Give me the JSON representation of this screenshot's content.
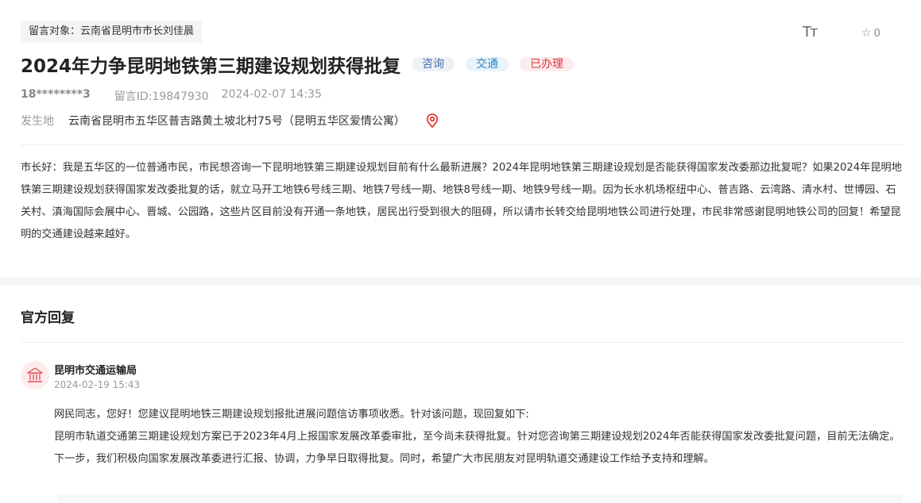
{
  "header": {
    "target_tag": "留言对象：云南省昆明市市长刘佳晨",
    "font_size_icon": "Tт",
    "favorite_count": "0",
    "title": "2024年力争昆明地铁第三期建设规划获得批复",
    "tags": {
      "consult": "咨询",
      "traffic": "交通",
      "status": "已办理"
    }
  },
  "meta": {
    "user": "18********3",
    "message_id": "留言ID:19847930",
    "datetime": "2024-02-07 14:35"
  },
  "place": {
    "label": "发生地",
    "value": "云南省昆明市五华区普吉路黄土坡北村75号（昆明五华区爱情公寓）"
  },
  "message": {
    "content": "市长好：我是五华区的一位普通市民，市民想咨询一下昆明地铁第三期建设规划目前有什么最新进展？2024年昆明地铁第三期建设规划是否能获得国家发改委那边批复呢？如果2024年昆明地铁第三期建设规划获得国家发改委批复的话，就立马开工地铁6号线三期、地铁7号线一期、地铁8号线一期、地铁9号线一期。因为长水机场枢纽中心、普吉路、云湾路、清水村、世博园、石关村、滇海国际会展中心、晋城、公园路，这些片区目前没有开通一条地铁，居民出行受到很大的阻碍，所以请市长转交给昆明地铁公司进行处理，市民非常感谢昆明地铁公司的回复！希望昆明的交通建设越来越好。"
  },
  "reply": {
    "heading": "官方回复",
    "org_name": "昆明市交通运输局",
    "date": "2024-02-19 15:43",
    "paragraph1": "网民同志，您好！您建议昆明地铁三期建设规划报批进展问题信访事项收悉。针对该问题，现回复如下:",
    "paragraph2": "昆明市轨道交通第三期建设规划方案已于2023年4月上报国家发展改革委审批，至今尚未获得批复。针对您咨询第三期建设规划2024年否能获得国家发改委批复问题，目前无法确定。下一步，我们积极向国家发展改革委进行汇报、协调，力争早日取得批复。同时，希望广大市民朋友对昆明轨道交通建设工作给予支持和理解。"
  },
  "icons": {
    "font_size": "font-size-icon",
    "favorite": "star-icon",
    "location": "location-pin-icon",
    "avatar": "government-building-icon"
  },
  "colors": {
    "accent_red": "#d9363e",
    "tag_blue": "#2b86c6",
    "tag_gray_blue": "#4a6ea9"
  }
}
